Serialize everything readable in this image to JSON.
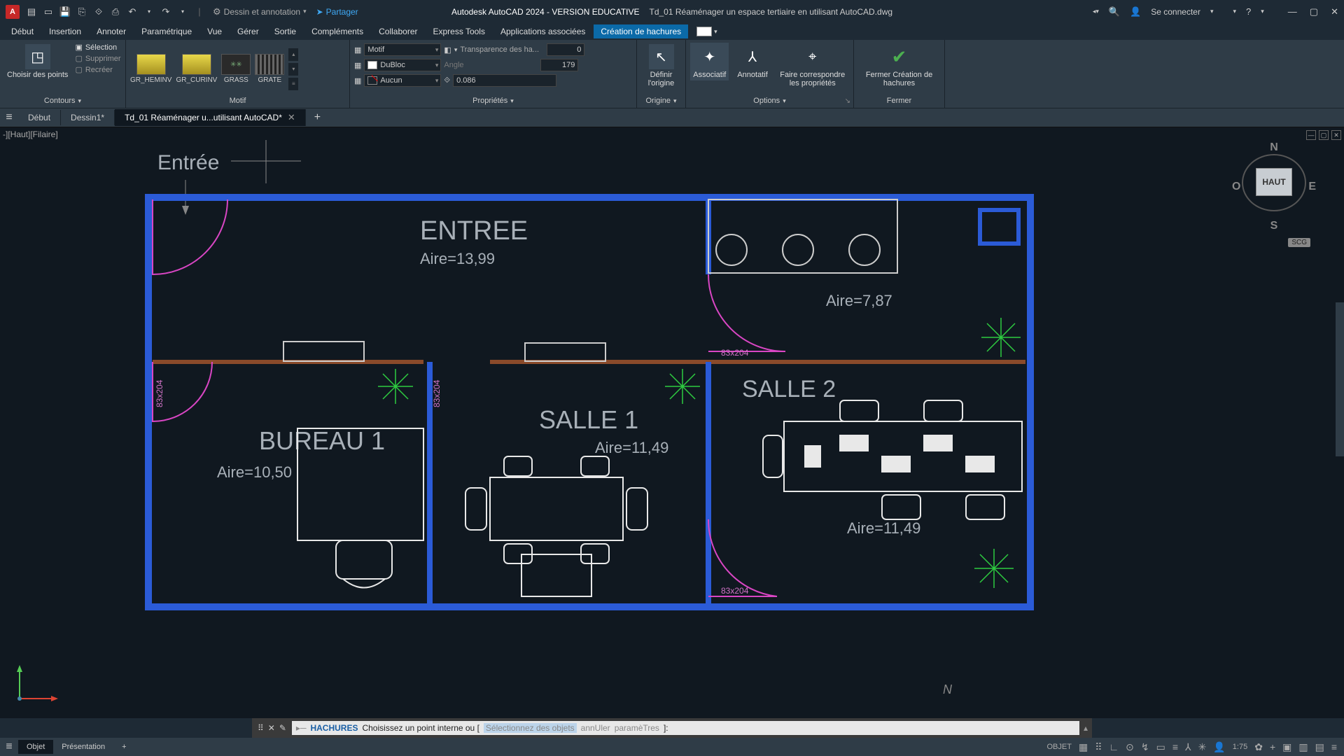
{
  "title": {
    "app": "Autodesk AutoCAD 2024 - VERSION EDUCATIVE",
    "file": "Td_01 Réaménager un espace tertiaire en utilisant AutoCAD.dwg",
    "workspace": "Dessin et annotation",
    "share": "Partager",
    "signin": "Se connecter",
    "app_initial": "A"
  },
  "menu": {
    "items": [
      "Début",
      "Insertion",
      "Annoter",
      "Paramétrique",
      "Vue",
      "Gérer",
      "Sortie",
      "Compléments",
      "Collaborer",
      "Express Tools",
      "Applications associées",
      "Création de hachures"
    ],
    "active": "Création de hachures"
  },
  "ribbon": {
    "boundaries": {
      "title": "Contours",
      "main": "Choisir des points",
      "options": [
        "Sélection",
        "Supprimer",
        "Recréer"
      ]
    },
    "pattern": {
      "title": "Motif",
      "items": [
        "GR_HEMINV",
        "GR_CURINV",
        "GRASS",
        "GRATE"
      ]
    },
    "props": {
      "title": "Propriétés",
      "type_label": "Motif",
      "transp_label": "Transparence des ha...",
      "transp_val": "0",
      "color": "DuBloc",
      "angle_label": "Angle",
      "angle_val": "179",
      "bg": "Aucun",
      "scale": "0.086"
    },
    "origin": {
      "title": "Origine",
      "btn": "Définir l'origine"
    },
    "assoc": {
      "btn": "Associatif"
    },
    "annot": {
      "btn": "Annotatif"
    },
    "match": {
      "btn": "Faire correspondre les propriétés"
    },
    "options": {
      "title": "Options"
    },
    "close": {
      "title": "Fermer",
      "btn": "Fermer Création de hachures"
    }
  },
  "tabs": {
    "items": [
      "Début",
      "Dessin1*",
      "Td_01 Réaménager u...utilisant AutoCAD*"
    ],
    "active": 2
  },
  "viewport": {
    "label": "-][Haut][Filaire]"
  },
  "viewcube": {
    "n": "N",
    "s": "S",
    "e": "E",
    "o": "O",
    "face": "HAUT",
    "scg": "SCG"
  },
  "plan": {
    "entree_label": "Entrée",
    "entree": {
      "name": "ENTREE",
      "area": "Aire=13,99"
    },
    "vest": {
      "area": "Aire=7,87"
    },
    "bureau": {
      "name": "BUREAU 1",
      "area": "Aire=10,50"
    },
    "salle1": {
      "name": "SALLE 1",
      "area": "Aire=11,49"
    },
    "salle2": {
      "name": "SALLE 2",
      "area": "Aire=11,49"
    },
    "dim1": "83x204",
    "dim2": "83x204",
    "dim3": "83x204",
    "dim4": "83x204"
  },
  "cmd": {
    "prefix": "HACHURES",
    "text": "Choisissez un point interne ou [",
    "opt1": "Sélectionnez des objets",
    "opt2": "annUler",
    "opt3": "paramèTres",
    "suffix": "]:"
  },
  "layout": {
    "tabs": [
      "Objet",
      "Présentation"
    ],
    "active": 0
  },
  "status": {
    "word": "OBJET",
    "scale": "1:75"
  }
}
